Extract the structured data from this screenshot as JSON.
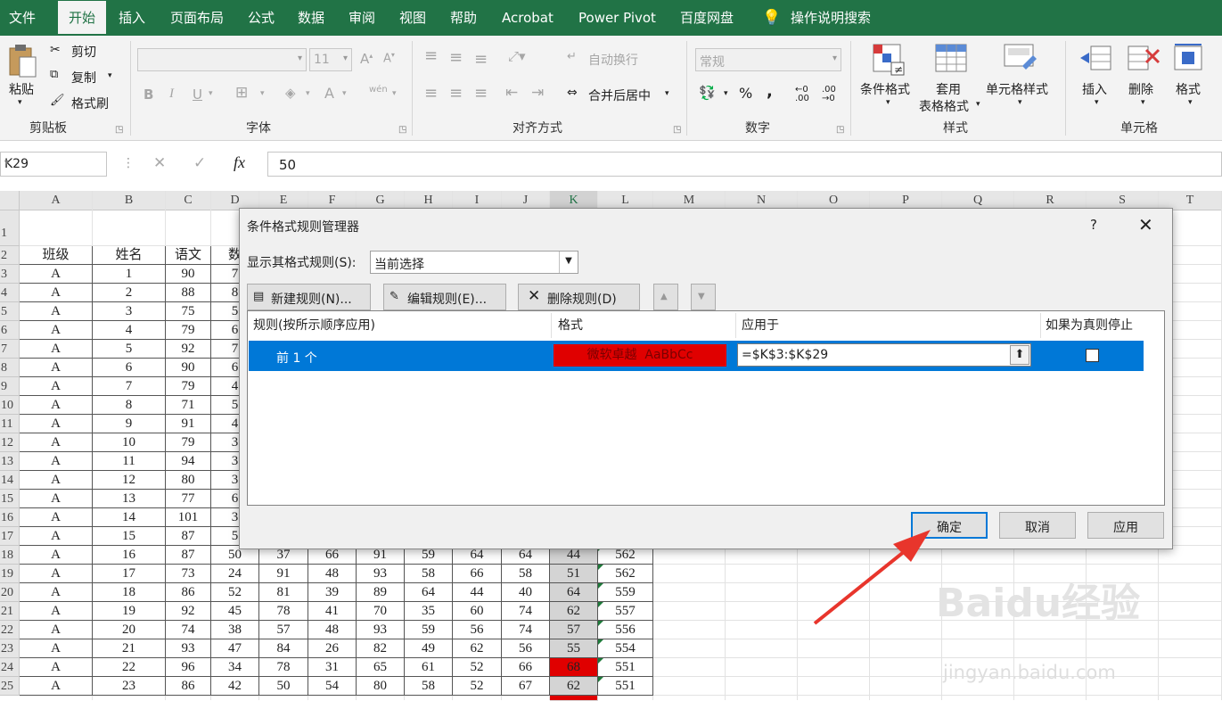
{
  "ribbon_tabs": [
    "文件",
    "开始",
    "插入",
    "页面布局",
    "公式",
    "数据",
    "审阅",
    "视图",
    "帮助",
    "Acrobat",
    "Power Pivot",
    "百度网盘"
  ],
  "active_tab": "开始",
  "tell_me": "操作说明搜索",
  "clipboard": {
    "paste": "粘贴",
    "cut": "剪切",
    "copy": "复制",
    "format_painter": "格式刷",
    "label": "剪贴板"
  },
  "font": {
    "size": "11",
    "label": "字体",
    "bold": "B",
    "italic": "I",
    "underline": "U",
    "grow": "A",
    "shrink": "A",
    "color": "A",
    "phonetic": "wén"
  },
  "alignment": {
    "wrap": "自动换行",
    "merge": "合并后居中",
    "label": "对齐方式"
  },
  "number": {
    "format": "常规",
    "label": "数字",
    "percent": "%",
    "comma": ","
  },
  "styles": {
    "conditional": "条件格式",
    "table_1": "套用",
    "table_2": "表格格式",
    "cell_styles": "单元格样式",
    "label": "样式"
  },
  "cells": {
    "insert": "插入",
    "delete": "删除",
    "format": "格式",
    "label": "单元格"
  },
  "name_box": "K29",
  "formula_value": "50",
  "formula_fx": "fx",
  "columns": [
    "A",
    "B",
    "C",
    "D",
    "E",
    "F",
    "G",
    "H",
    "I",
    "J",
    "K",
    "L",
    "M",
    "N",
    "O",
    "P",
    "Q",
    "R",
    "S",
    "T"
  ],
  "selected_column": "K",
  "row_numbers": [
    "1",
    "2",
    "3",
    "4",
    "5",
    "6",
    "7",
    "8",
    "9",
    "10",
    "11",
    "12",
    "13",
    "14",
    "15",
    "16",
    "17",
    "18",
    "19",
    "20",
    "21",
    "22",
    "23",
    "24",
    "25"
  ],
  "header_row": [
    "班级",
    "姓名",
    "语文",
    "数"
  ],
  "rows_visible_left": [
    [
      "A",
      "1",
      "90",
      "7"
    ],
    [
      "A",
      "2",
      "88",
      "8"
    ],
    [
      "A",
      "3",
      "75",
      "5"
    ],
    [
      "A",
      "4",
      "79",
      "6"
    ],
    [
      "A",
      "5",
      "92",
      "7"
    ],
    [
      "A",
      "6",
      "90",
      "6"
    ],
    [
      "A",
      "7",
      "79",
      "4"
    ],
    [
      "A",
      "8",
      "71",
      "5"
    ],
    [
      "A",
      "9",
      "91",
      "4"
    ],
    [
      "A",
      "10",
      "79",
      "3"
    ],
    [
      "A",
      "11",
      "94",
      "3"
    ],
    [
      "A",
      "12",
      "80",
      "3"
    ],
    [
      "A",
      "13",
      "77",
      "6"
    ],
    [
      "A",
      "14",
      "101",
      "3"
    ],
    [
      "A",
      "15",
      "87",
      "5"
    ]
  ],
  "rows_full": [
    [
      "A",
      "16",
      "87",
      "50",
      "37",
      "66",
      "91",
      "59",
      "64",
      "64",
      "44",
      "562"
    ],
    [
      "A",
      "17",
      "73",
      "24",
      "91",
      "48",
      "93",
      "58",
      "66",
      "58",
      "51",
      "562"
    ],
    [
      "A",
      "18",
      "86",
      "52",
      "81",
      "39",
      "89",
      "64",
      "44",
      "40",
      "64",
      "559"
    ],
    [
      "A",
      "19",
      "92",
      "45",
      "78",
      "41",
      "70",
      "35",
      "60",
      "74",
      "62",
      "557"
    ],
    [
      "A",
      "20",
      "74",
      "38",
      "57",
      "48",
      "93",
      "59",
      "56",
      "74",
      "57",
      "556"
    ],
    [
      "A",
      "21",
      "93",
      "47",
      "84",
      "26",
      "82",
      "49",
      "62",
      "56",
      "55",
      "554"
    ],
    [
      "A",
      "22",
      "96",
      "34",
      "78",
      "31",
      "65",
      "61",
      "52",
      "66",
      "68",
      "551"
    ],
    [
      "A",
      "23",
      "86",
      "42",
      "50",
      "54",
      "80",
      "58",
      "52",
      "67",
      "62",
      "551"
    ]
  ],
  "highlight_row_index": 6,
  "dialog": {
    "title": "条件格式规则管理器",
    "help": "?",
    "close": "✕",
    "show_label": "显示其格式规则(S):",
    "show_value": "当前选择",
    "new_rule": "新建规则(N)...",
    "edit_rule": "编辑规则(E)...",
    "delete_rule": "删除规则(D)",
    "col_rule": "规则(按所示顺序应用)",
    "col_format": "格式",
    "col_applies": "应用于",
    "col_stop": "如果为真则停止",
    "rule_name": "前 1 个",
    "format_preview": "微软卓越  AaBbCc",
    "applies_to": "=$K$3:$K$29",
    "stop_checked": false,
    "ok": "确定",
    "cancel": "取消",
    "apply": "应用"
  },
  "watermark": {
    "brand": "Baidu经验",
    "url": "jingyan.baidu.com"
  },
  "colors": {
    "excel_green": "#217346",
    "selection_blue": "#0078d7",
    "format_red": "#e00000",
    "arrow_red": "#e8352c"
  }
}
